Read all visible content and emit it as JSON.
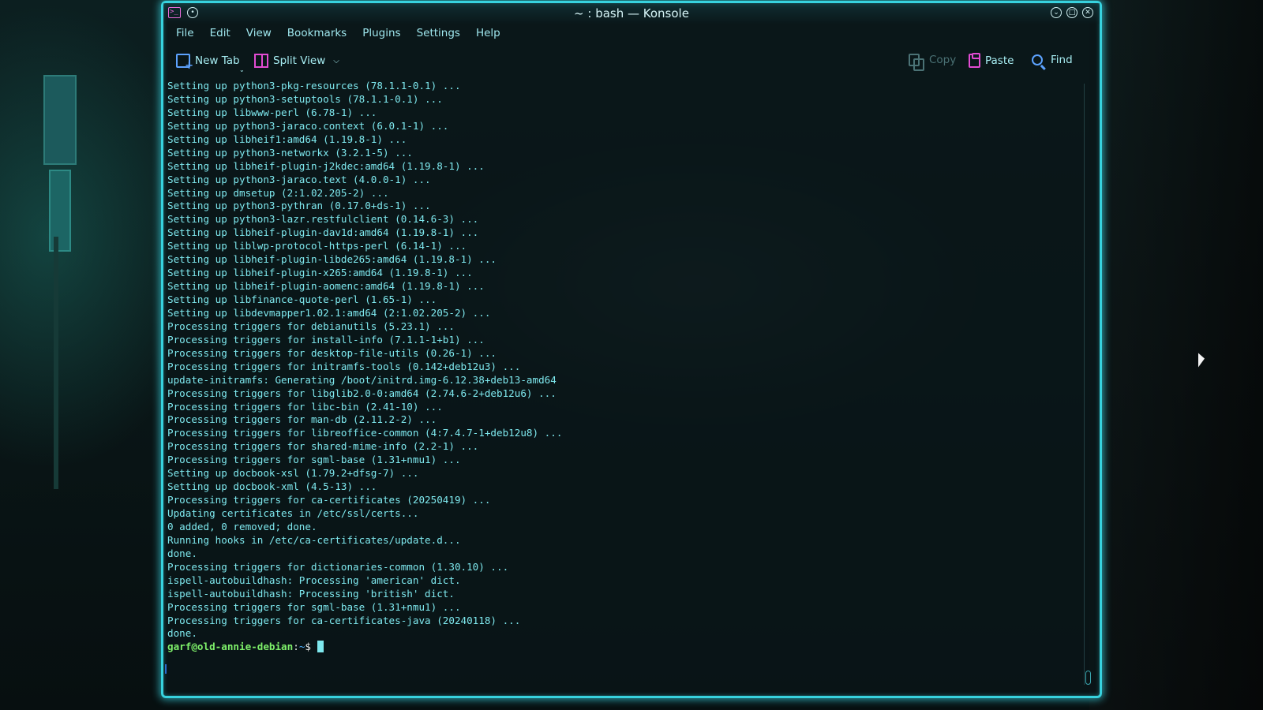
{
  "window": {
    "title": "~ : bash — Konsole"
  },
  "menu": [
    "File",
    "Edit",
    "View",
    "Bookmarks",
    "Plugins",
    "Settings",
    "Help"
  ],
  "toolbar": {
    "new_tab": "New Tab",
    "split_view": "Split View",
    "copy": "Copy",
    "paste": "Paste",
    "find": "Find"
  },
  "terminal": {
    "lines": [
      "Setting up python3-pkg-resources (78.1.1-0.1) ...",
      "Setting up python3-setuptools (78.1.1-0.1) ...",
      "Setting up libwww-perl (6.78-1) ...",
      "Setting up python3-jaraco.context (6.0.1-1) ...",
      "Setting up libheif1:amd64 (1.19.8-1) ...",
      "Setting up python3-networkx (3.2.1-5) ...",
      "Setting up libheif-plugin-j2kdec:amd64 (1.19.8-1) ...",
      "Setting up python3-jaraco.text (4.0.0-1) ...",
      "Setting up dmsetup (2:1.02.205-2) ...",
      "Setting up python3-pythran (0.17.0+ds-1) ...",
      "Setting up python3-lazr.restfulclient (0.14.6-3) ...",
      "Setting up libheif-plugin-dav1d:amd64 (1.19.8-1) ...",
      "Setting up liblwp-protocol-https-perl (6.14-1) ...",
      "Setting up libheif-plugin-libde265:amd64 (1.19.8-1) ...",
      "Setting up libheif-plugin-x265:amd64 (1.19.8-1) ...",
      "Setting up libheif-plugin-aomenc:amd64 (1.19.8-1) ...",
      "Setting up libfinance-quote-perl (1.65-1) ...",
      "Setting up libdevmapper1.02.1:amd64 (2:1.02.205-2) ...",
      "Processing triggers for debianutils (5.23.1) ...",
      "Processing triggers for install-info (7.1.1-1+b1) ...",
      "Processing triggers for desktop-file-utils (0.26-1) ...",
      "Processing triggers for initramfs-tools (0.142+deb12u3) ...",
      "update-initramfs: Generating /boot/initrd.img-6.12.38+deb13-amd64",
      "Processing triggers for libglib2.0-0:amd64 (2.74.6-2+deb12u6) ...",
      "Processing triggers for libc-bin (2.41-10) ...",
      "Processing triggers for man-db (2.11.2-2) ...",
      "Processing triggers for libreoffice-common (4:7.4.7-1+deb12u8) ...",
      "Processing triggers for shared-mime-info (2.2-1) ...",
      "Processing triggers for sgml-base (1.31+nmu1) ...",
      "Setting up docbook-xsl (1.79.2+dfsg-7) ...",
      "Setting up docbook-xml (4.5-13) ...",
      "Processing triggers for ca-certificates (20250419) ...",
      "Updating certificates in /etc/ssl/certs...",
      "0 added, 0 removed; done.",
      "Running hooks in /etc/ca-certificates/update.d...",
      "done.",
      "Processing triggers for dictionaries-common (1.30.10) ...",
      "ispell-autobuildhash: Processing 'american' dict.",
      "ispell-autobuildhash: Processing 'british' dict.",
      "Processing triggers for sgml-base (1.31+nmu1) ...",
      "Processing triggers for ca-certificates-java (20240118) ...",
      "done."
    ],
    "prompt": {
      "user_host": "garf@old-annie-debian",
      "sep": ":",
      "path": "~",
      "symbol": "$ "
    }
  },
  "icons": {
    "app": "terminal-icon",
    "pin": "pin-icon",
    "minimize": "chevron-down-icon",
    "maximize": "maximize-icon",
    "close": "close-icon",
    "new_tab": "new-tab-icon",
    "split_view": "split-view-icon",
    "copy": "copy-icon",
    "paste": "clipboard-icon",
    "find": "search-icon"
  },
  "colors": {
    "accent": "#37d2de",
    "prompt_user": "#7ef06a",
    "prompt_path": "#4fb0ff",
    "terminal_text": "#7ee8ee"
  }
}
